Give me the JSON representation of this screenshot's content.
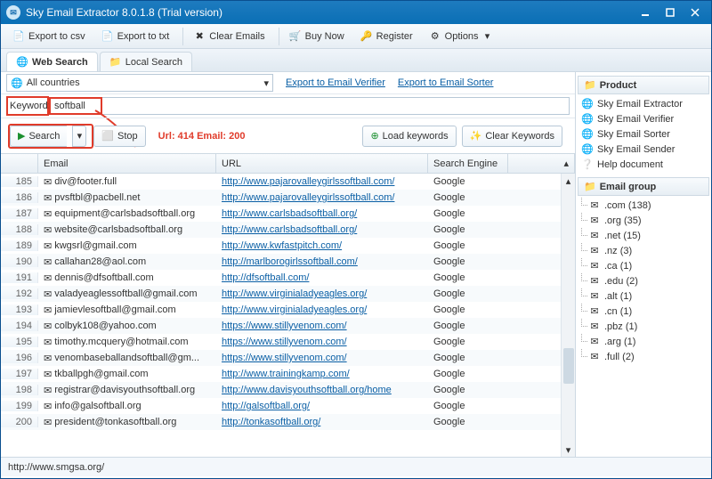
{
  "window": {
    "title": "Sky Email Extractor 8.0.1.8 (Trial version)"
  },
  "toolbar": {
    "export_csv": "Export to csv",
    "export_txt": "Export to txt",
    "clear_emails": "Clear Emails",
    "buy_now": "Buy Now",
    "register": "Register",
    "options": "Options"
  },
  "tabs": {
    "web": "Web Search",
    "local": "Local Search"
  },
  "filter": {
    "country": "All countries",
    "link_verifier": "Export to Email Verifier",
    "link_sorter": "Export to Email Sorter"
  },
  "keyword": {
    "label": "Keyword:",
    "value": "softball"
  },
  "controls": {
    "search": "Search",
    "stop": "Stop",
    "stats": "Url: 414 Email: 200",
    "load_kw": "Load keywords",
    "clear_kw": "Clear Keywords"
  },
  "grid": {
    "headers": {
      "email": "Email",
      "url": "URL",
      "engine": "Search Engine"
    },
    "rows": [
      {
        "n": 185,
        "email": "div@footer.full",
        "url": "http://www.pajarovalleygirlssoftball.com/",
        "engine": "Google"
      },
      {
        "n": 186,
        "email": "pvsftbl@pacbell.net",
        "url": "http://www.pajarovalleygirlssoftball.com/",
        "engine": "Google"
      },
      {
        "n": 187,
        "email": "equipment@carlsbadsoftball.org",
        "url": "http://www.carlsbadsoftball.org/",
        "engine": "Google"
      },
      {
        "n": 188,
        "email": "website@carlsbadsoftball.org",
        "url": "http://www.carlsbadsoftball.org/",
        "engine": "Google"
      },
      {
        "n": 189,
        "email": "kwgsrl@gmail.com",
        "url": "http://www.kwfastpitch.com/",
        "engine": "Google"
      },
      {
        "n": 190,
        "email": "callahan28@aol.com",
        "url": "http://marlborogirlssoftball.com/",
        "engine": "Google"
      },
      {
        "n": 191,
        "email": "dennis@dfsoftball.com",
        "url": "http://dfsoftball.com/",
        "engine": "Google"
      },
      {
        "n": 192,
        "email": "valadyeaglessoftball@gmail.com",
        "url": "http://www.virginialadyeagles.org/",
        "engine": "Google"
      },
      {
        "n": 193,
        "email": "jamievlesoftball@gmail.com",
        "url": "http://www.virginialadyeagles.org/",
        "engine": "Google"
      },
      {
        "n": 194,
        "email": "colbyk108@yahoo.com",
        "url": "https://www.stillyvenom.com/",
        "engine": "Google"
      },
      {
        "n": 195,
        "email": "timothy.mcquery@hotmail.com",
        "url": "https://www.stillyvenom.com/",
        "engine": "Google"
      },
      {
        "n": 196,
        "email": "venombaseballandsoftball@gm...",
        "url": "https://www.stillyvenom.com/",
        "engine": "Google"
      },
      {
        "n": 197,
        "email": "tkballpgh@gmail.com",
        "url": "http://www.trainingkamp.com/",
        "engine": "Google"
      },
      {
        "n": 198,
        "email": "registrar@davisyouthsoftball.org",
        "url": "http://www.davisyouthsoftball.org/home",
        "engine": "Google"
      },
      {
        "n": 199,
        "email": "info@galsoftball.org",
        "url": "http://galsoftball.org/",
        "engine": "Google"
      },
      {
        "n": 200,
        "email": "president@tonkasoftball.org",
        "url": "http://tonkasoftball.org/",
        "engine": "Google"
      }
    ]
  },
  "side": {
    "product": {
      "title": "Product",
      "items": [
        "Sky Email Extractor",
        "Sky Email Verifier",
        "Sky Email Sorter",
        "Sky Email Sender",
        "Help document"
      ]
    },
    "group": {
      "title": "Email group",
      "items": [
        ".com (138)",
        ".org (35)",
        ".net (15)",
        ".nz (3)",
        ".ca (1)",
        ".edu (2)",
        ".alt (1)",
        ".cn (1)",
        ".pbz (1)",
        ".arg (1)",
        ".full (2)"
      ]
    }
  },
  "status": {
    "text": "http://www.smgsa.org/"
  }
}
